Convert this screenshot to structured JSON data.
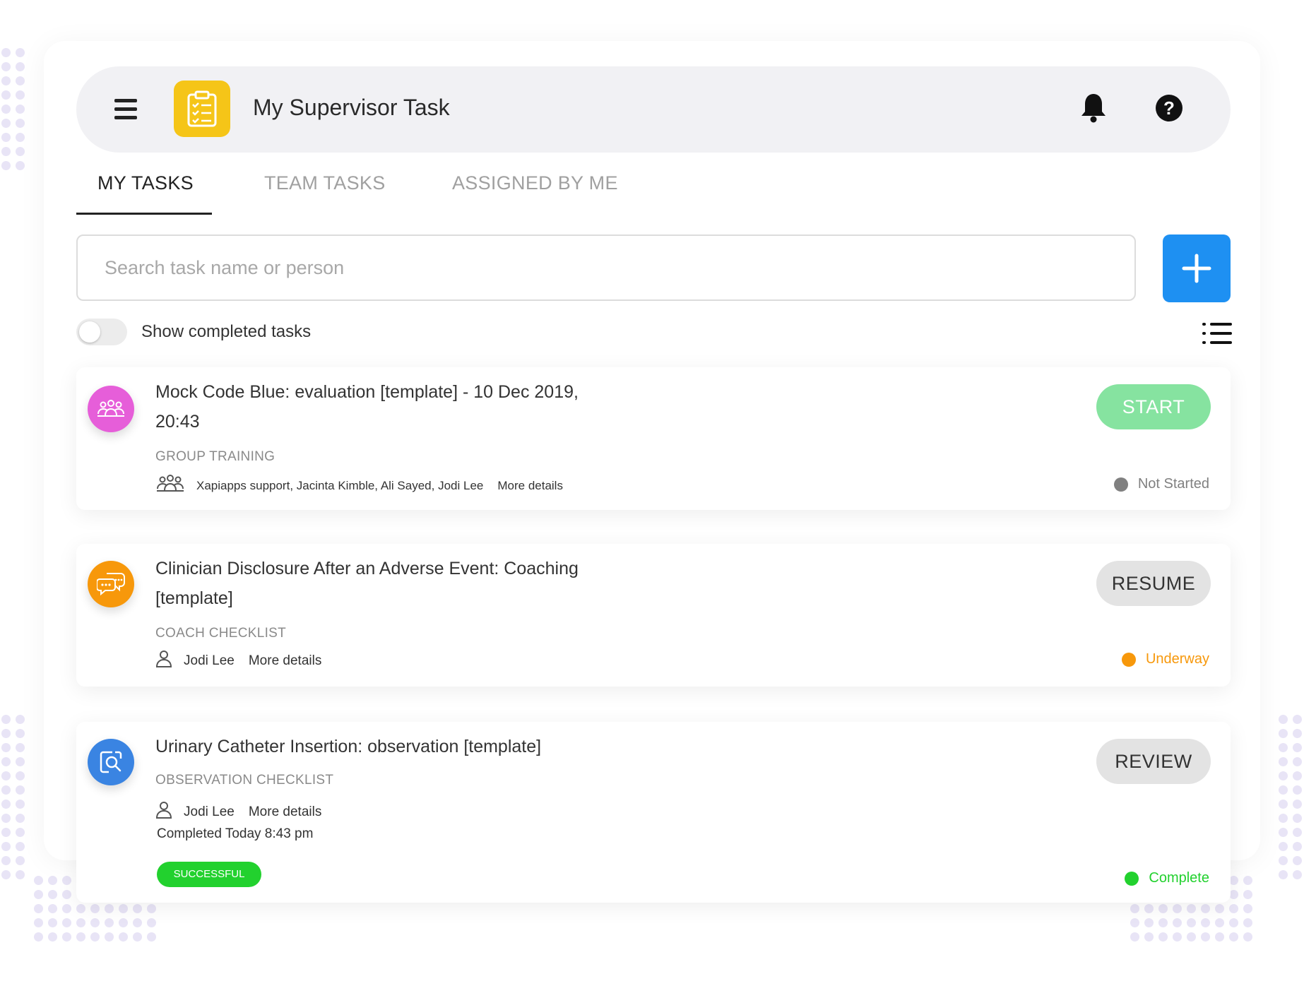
{
  "app": {
    "title": "My Supervisor Task",
    "logo_icon": "clipboard-checklist-icon",
    "accent_color": "#f5c518"
  },
  "header": {
    "menu_icon": "hamburger-menu-icon",
    "notification_icon": "bell-icon",
    "help_icon": "question-mark-icon"
  },
  "tabs": [
    {
      "label": "MY TASKS",
      "active": true
    },
    {
      "label": "TEAM TASKS",
      "active": false
    },
    {
      "label": "ASSIGNED BY ME",
      "active": false
    }
  ],
  "search": {
    "placeholder": "Search task name or person",
    "value": ""
  },
  "add_button": {
    "icon": "plus-icon",
    "color": "#1e90f2"
  },
  "toggle": {
    "label": "Show completed tasks",
    "checked": false
  },
  "view_icon": "list-view-icon",
  "tasks": [
    {
      "title": "Mock Code Blue: evaluation [template] - 10 Dec 2019, 20:43",
      "type": "GROUP TRAINING",
      "icon": "group-icon",
      "icon_color": "#e65ed9",
      "people_icon": "group-icon",
      "people": "Xapiapps support, Jacinta Kimble, Ali Sayed, Jodi Lee",
      "more_details": "More details",
      "action": "START",
      "action_bg": "#86e3a0",
      "action_color": "#ffffff",
      "status": "Not Started",
      "status_color": "#808080"
    },
    {
      "title": "Clinician Disclosure After an Adverse Event: Coaching [template]",
      "type": "COACH CHECKLIST",
      "icon": "speech-bubbles-icon",
      "icon_color": "#f7980b",
      "people_icon": "person-icon",
      "people": "Jodi Lee",
      "more_details": "More details",
      "action": "RESUME",
      "action_bg": "#e3e3e3",
      "action_color": "#333333",
      "status": "Underway",
      "status_color": "#f7980b"
    },
    {
      "title": "Urinary Catheter Insertion: observation [template]",
      "type": "OBSERVATION CHECKLIST",
      "icon": "search-document-icon",
      "icon_color": "#3a84e2",
      "people_icon": "person-icon",
      "people": "Jodi Lee",
      "more_details": "More details",
      "completed": "Completed Today 8:43 pm",
      "result_badge": "SUCCESSFUL",
      "result_color": "#22d12e",
      "action": "REVIEW",
      "action_bg": "#e3e3e3",
      "action_color": "#333333",
      "status": "Complete",
      "status_color": "#22d12e"
    }
  ]
}
